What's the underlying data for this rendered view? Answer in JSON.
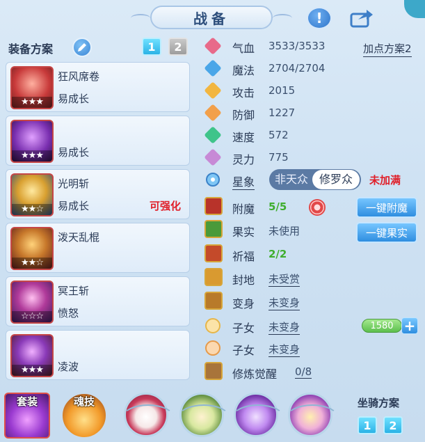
{
  "header": {
    "title": "战备",
    "help_icon": "exclamation-icon",
    "share_icon": "share-arrow-icon"
  },
  "equipment": {
    "title": "装备方案",
    "plans": [
      "1",
      "2"
    ],
    "active_plan": "1",
    "slots": [
      {
        "name": "狂风席卷",
        "sub": "易成长",
        "tag": "",
        "stars": "★★★",
        "icon": "fan-weapon-icon",
        "color": "#e04545"
      },
      {
        "name": "",
        "sub": "易成长",
        "tag": "",
        "stars": "★★★",
        "icon": "purple-armor-icon",
        "color": "#7a2fb0"
      },
      {
        "name": "光明斩",
        "sub": "易成长",
        "tag": "可强化",
        "stars": "★★☆",
        "icon": "golden-armor-icon",
        "color": "#d9a030"
      },
      {
        "name": "泼天乱棍",
        "sub": "",
        "tag": "",
        "stars": "★★☆",
        "icon": "dragon-staff-icon",
        "color": "#c7782b"
      },
      {
        "name": "冥王斩",
        "sub": "愤怒",
        "tag": "",
        "stars": "☆☆☆",
        "icon": "crown-helm-icon",
        "color": "#b03a9a"
      },
      {
        "name": "",
        "sub": "凌波",
        "tag": "",
        "stars": "★★★",
        "icon": "armored-boots-icon",
        "color": "#8a3ab8"
      }
    ]
  },
  "stats": {
    "add_point_plan": "加点方案2",
    "rows": [
      {
        "label": "气血",
        "value": "3533/3533",
        "icon": "heart-icon",
        "color": "#e86a8a"
      },
      {
        "label": "魔法",
        "value": "2704/2704",
        "icon": "mana-icon",
        "color": "#4aa6e8"
      },
      {
        "label": "攻击",
        "value": "2015",
        "icon": "sword-icon",
        "color": "#f2b640"
      },
      {
        "label": "防御",
        "value": "1227",
        "icon": "shield-icon",
        "color": "#f2a04a"
      },
      {
        "label": "速度",
        "value": "572",
        "icon": "speed-icon",
        "color": "#3fc48a"
      },
      {
        "label": "灵力",
        "value": "775",
        "icon": "spirit-icon",
        "color": "#c78ad6"
      }
    ],
    "star_sign": {
      "label": "星象",
      "option_a": "非天众",
      "option_b": "修罗众",
      "status": "未加满"
    }
  },
  "abilities": {
    "enchant": {
      "label": "附魔",
      "value": "5/5",
      "button": "一键附魔"
    },
    "fruit": {
      "label": "果实",
      "value": "未使用",
      "button": "一键果实"
    },
    "blessing": {
      "label": "祈福",
      "value": "2/2"
    },
    "fief": {
      "label": "封地",
      "value": "未受赏"
    },
    "transform": {
      "label": "变身",
      "value": "未变身"
    },
    "child1": {
      "label": "子女",
      "value": "未变身"
    },
    "child2": {
      "label": "子女",
      "value": "未变身"
    },
    "awaken": {
      "label": "修炼觉醒",
      "value": "0/8"
    },
    "points": "1580"
  },
  "bottom": {
    "suit_label": "套装",
    "soul_skill_label": "魂技",
    "mount_title": "坐骑方案",
    "mount_plans": [
      "1",
      "2"
    ]
  }
}
